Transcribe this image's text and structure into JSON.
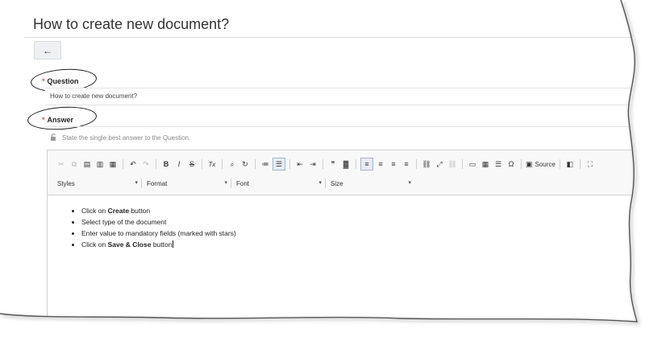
{
  "page": {
    "title": "How to create new document?"
  },
  "back": {
    "icon": "arrow-left-icon",
    "glyph": "←"
  },
  "question": {
    "required_mark": "*",
    "label": "Question",
    "value": "How to create new document?"
  },
  "answer": {
    "required_mark": "*",
    "label": "Answer",
    "hint": "State the single best answer to the Question.",
    "hint_icon": "lock-open-icon"
  },
  "toolbar": {
    "row1": [
      {
        "name": "cut-icon",
        "glyph": "✂",
        "dim": true
      },
      {
        "name": "copy-icon",
        "glyph": "⧉",
        "dim": true
      },
      {
        "name": "paste-icon",
        "glyph": "▤"
      },
      {
        "name": "paste-text-icon",
        "glyph": "▥"
      },
      {
        "name": "paste-word-icon",
        "glyph": "▦"
      },
      {
        "sep": true
      },
      {
        "name": "undo-icon",
        "glyph": "↶"
      },
      {
        "name": "redo-icon",
        "glyph": "↷",
        "dim": true
      },
      {
        "sep": true
      },
      {
        "name": "bold-icon",
        "glyph": "B",
        "bold": true
      },
      {
        "name": "italic-icon",
        "glyph": "I",
        "italic": true
      },
      {
        "name": "strike-icon",
        "glyph": "S",
        "strike": true
      },
      {
        "sep": true
      },
      {
        "name": "remove-format-icon",
        "glyph": "Tx",
        "italic": true
      },
      {
        "sep": true
      },
      {
        "name": "find-icon",
        "glyph": "⌕"
      },
      {
        "name": "replace-icon",
        "glyph": "↻"
      },
      {
        "sep": true
      },
      {
        "name": "numbered-list-icon",
        "glyph": "≔"
      },
      {
        "name": "bulleted-list-icon",
        "glyph": "☰",
        "active": true
      },
      {
        "sep": true
      },
      {
        "name": "outdent-icon",
        "glyph": "⇤"
      },
      {
        "name": "indent-icon",
        "glyph": "⇥"
      },
      {
        "sep": true
      },
      {
        "name": "blockquote-icon",
        "glyph": "❞"
      },
      {
        "name": "div-icon",
        "glyph": "▓"
      },
      {
        "sep": true
      },
      {
        "name": "align-left-icon",
        "glyph": "≡",
        "active": true
      },
      {
        "name": "align-center-icon",
        "glyph": "≡"
      },
      {
        "name": "align-right-icon",
        "glyph": "≡"
      },
      {
        "name": "justify-icon",
        "glyph": "≡"
      },
      {
        "sep": true
      },
      {
        "name": "link-icon",
        "glyph": "⛓"
      },
      {
        "name": "maximize-icon",
        "glyph": "⤢"
      },
      {
        "name": "unlink-icon",
        "glyph": "⛓",
        "dim": true
      },
      {
        "sep": true
      },
      {
        "name": "image-icon",
        "glyph": "▭"
      },
      {
        "name": "table-icon",
        "glyph": "▦"
      },
      {
        "name": "horizontal-line-icon",
        "glyph": "☰"
      },
      {
        "name": "special-char-icon",
        "glyph": "Ω"
      },
      {
        "sep": true
      },
      {
        "name": "source-icon",
        "glyph": "▣",
        "label_key": "source"
      },
      {
        "sep": true
      },
      {
        "name": "preview-icon",
        "glyph": "◧"
      },
      {
        "sep": true
      },
      {
        "name": "fullscreen-icon",
        "glyph": "⛶"
      }
    ],
    "source_label": "Source",
    "combos": [
      {
        "name": "styles-combo",
        "label": "Styles",
        "width": 104
      },
      {
        "name": "format-combo",
        "label": "Format",
        "width": 104
      },
      {
        "name": "font-combo",
        "label": "Font",
        "width": 110
      },
      {
        "name": "size-combo",
        "label": "Size",
        "width": 104
      }
    ],
    "combo_arrow": "▾"
  },
  "content": {
    "items": [
      {
        "parts": [
          {
            "t": "Click on "
          },
          {
            "t": "Create",
            "b": true
          },
          {
            "t": " button"
          }
        ]
      },
      {
        "parts": [
          {
            "t": "Select type of the document"
          }
        ]
      },
      {
        "parts": [
          {
            "t": "Enter value to mandatory fields (marked with stars)"
          }
        ]
      },
      {
        "parts": [
          {
            "t": "Click on "
          },
          {
            "t": "Save & Close",
            "b": true
          },
          {
            "t": " button"
          }
        ],
        "caret": true
      }
    ]
  },
  "colors": {
    "required": "#d9534f",
    "toolbar_bg": "#f8f8f8",
    "border": "#d1d1d1"
  }
}
